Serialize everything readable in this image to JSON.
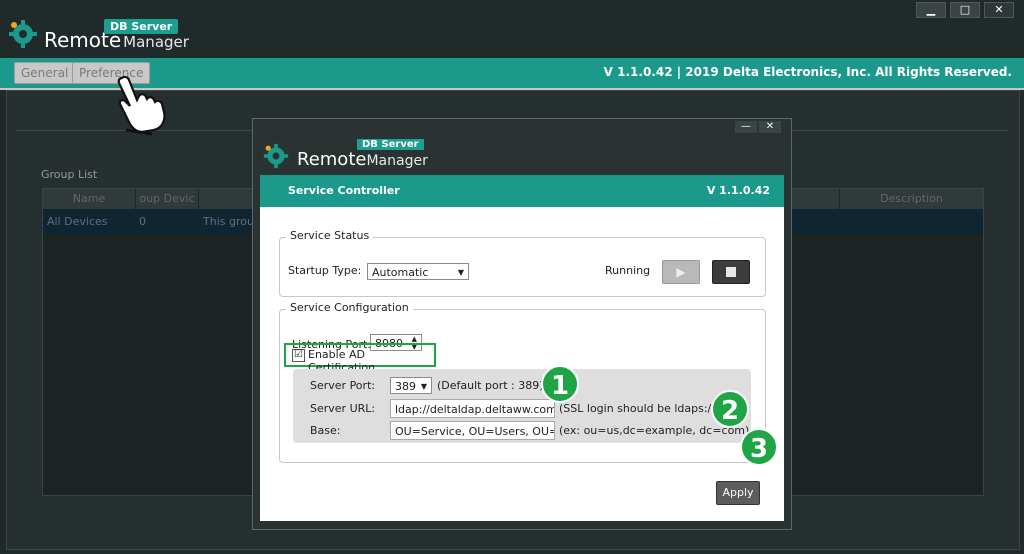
{
  "app": {
    "logo_remote": "Remote",
    "logo_manager": "Manager",
    "logo_badge": "DB Server",
    "window_controls": [
      "▁",
      "□",
      "✕"
    ]
  },
  "menubar": {
    "tabs": [
      {
        "label": "General"
      },
      {
        "label": "Preference"
      }
    ],
    "version": "V 1.1.0.42  |  2019 Delta Electronics, Inc. All Rights Reserved."
  },
  "background": {
    "group_list_label": "Group List",
    "columns": [
      "Name",
      "oup Devic",
      "",
      "Description"
    ],
    "row": [
      "All Devices",
      "0",
      "This group"
    ]
  },
  "dialog": {
    "controls": [
      "—",
      "✕"
    ],
    "logo_remote": "Remote",
    "logo_manager": "Manager",
    "logo_badge": "DB Server",
    "title": "Service Controller",
    "version": "V 1.1.0.42",
    "service_status": {
      "legend": "Service Status",
      "startup_label": "Startup Type:",
      "startup_value": "Automatic",
      "status_text": "Running"
    },
    "service_config": {
      "legend": "Service Configuration",
      "port_label": "Listening Port:",
      "port_value": "8080",
      "ad_cert_label": "Enable AD Certification",
      "ad_cert_checked": "☑",
      "server_port_label": "Server Port:",
      "server_port_value": "389",
      "server_port_hint": "(Default port : 389)",
      "server_url_label": "Server URL:",
      "server_url_value": "ldap://deltaldap.deltaww.com",
      "server_url_hint": "(SSL login should be ldaps://)",
      "base_label": "Base:",
      "base_value": "OU=Service, OU=Users, OU=T\\",
      "base_hint": "(ex: ou=us,dc=example, dc=com)"
    },
    "apply_label": "Apply"
  },
  "callouts": [
    "1",
    "2",
    "3"
  ],
  "colors": {
    "accent": "#1b9a8c",
    "highlight": "#1fa546"
  }
}
